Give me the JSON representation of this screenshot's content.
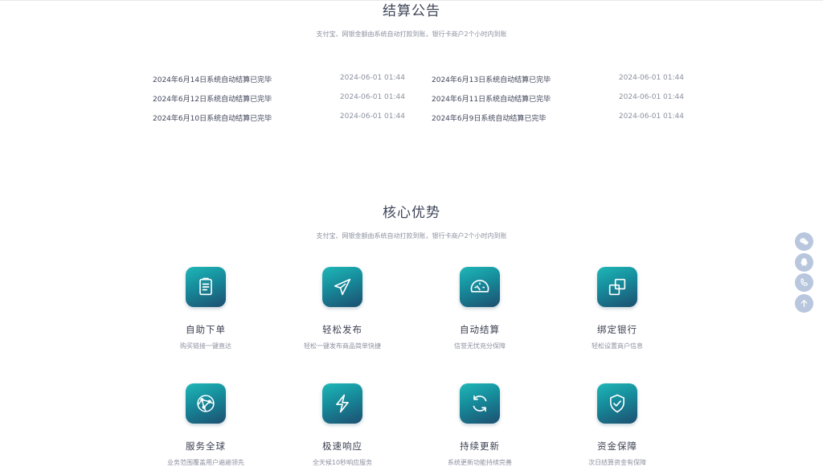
{
  "announcement": {
    "title": "结算公告",
    "subtitle": "支付宝、网银金额由系统自动打款到账，银行卡商户2个小时内到账",
    "items": [
      {
        "text": "2024年6月14日系统自动结算已完毕",
        "date": "2024-06-01 01:44"
      },
      {
        "text": "2024年6月13日系统自动结算已完毕",
        "date": "2024-06-01 01:44"
      },
      {
        "text": "2024年6月12日系统自动结算已完毕",
        "date": "2024-06-01 01:44"
      },
      {
        "text": "2024年6月11日系统自动结算已完毕",
        "date": "2024-06-01 01:44"
      },
      {
        "text": "2024年6月10日系统自动结算已完毕",
        "date": "2024-06-01 01:44"
      },
      {
        "text": "2024年6月9日系统自动结算已完毕",
        "date": "2024-06-01 01:44"
      }
    ]
  },
  "advantages": {
    "title": "核心优势",
    "subtitle": "支付宝、网银金额由系统自动打款到账，银行卡商户2个小时内到账",
    "features": [
      {
        "title": "自助下单",
        "desc": "购买链接一键直达",
        "icon": "clipboard-icon"
      },
      {
        "title": "轻松发布",
        "desc": "轻松一键发布商品简单快捷",
        "icon": "paper-plane-icon"
      },
      {
        "title": "自动结算",
        "desc": "信誉无忧充分保障",
        "icon": "speedometer-icon"
      },
      {
        "title": "绑定银行",
        "desc": "轻松设置商户信息",
        "icon": "layers-icon"
      },
      {
        "title": "服务全球",
        "desc": "业务范围覆盖用户遍遍领先",
        "icon": "globe-network-icon"
      },
      {
        "title": "极速响应",
        "desc": "全天候10秒响应服务",
        "icon": "lightning-icon"
      },
      {
        "title": "持续更新",
        "desc": "系统更新功能持续完善",
        "icon": "refresh-icon"
      },
      {
        "title": "资金保障",
        "desc": "次日结算资金有保障",
        "icon": "shield-check-icon"
      }
    ]
  },
  "floating_toolbar": [
    {
      "icon": "wechat-icon"
    },
    {
      "icon": "qq-icon"
    },
    {
      "icon": "phone-icon"
    },
    {
      "icon": "back-to-top-icon"
    }
  ],
  "colors": {
    "accent_gradient_start": "#1fb7b7",
    "accent_gradient_end": "#1d4f70",
    "float_button": "#b8c7dd"
  }
}
